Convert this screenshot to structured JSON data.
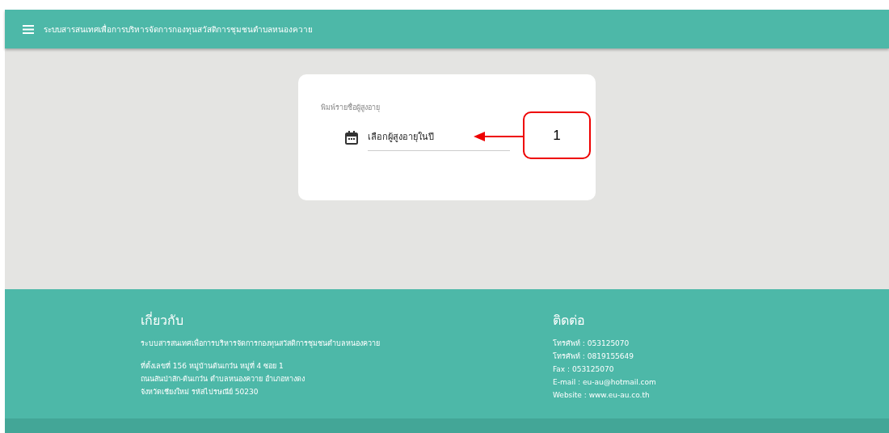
{
  "header": {
    "title": "ระบบสารสนเทศเพื่อการบริหารจัดการกองทุนสวัสดิการชุมชนตำบลหนองควาย"
  },
  "form": {
    "label": "พิมพ์รายชื่อผู้สูงอายุ",
    "value": "เลือกผู้สูงอายุในปี"
  },
  "callout": {
    "text": "1"
  },
  "footer": {
    "about": {
      "heading": "เกี่ยวกับ",
      "description": "ระบบสารสนเทศเพื่อการบริหารจัดการกองทุนสวัสดิการชุมชนตำบลหนองควาย",
      "address": [
        "ที่ตั้งเลขที่ 156 หมู่บ้านต้นเกว๋น หมู่ที่ 4 ซอย 1",
        "ถนนสันป่าสัก-ต้นเกว๋น ตำบลหนองควาย อำเภอหางดง",
        "จังหวัดเชียงใหม่ รหัสไปรษณีย์ 50230"
      ]
    },
    "contact": {
      "heading": "ติดต่อ",
      "lines": [
        "โทรศัพท์ : 053125070",
        "โทรศัพท์ : 0819155649",
        "Fax : 053125070",
        "E-mail : eu-au@hotmail.com",
        "Website : www.eu-au.co.th"
      ]
    }
  }
}
